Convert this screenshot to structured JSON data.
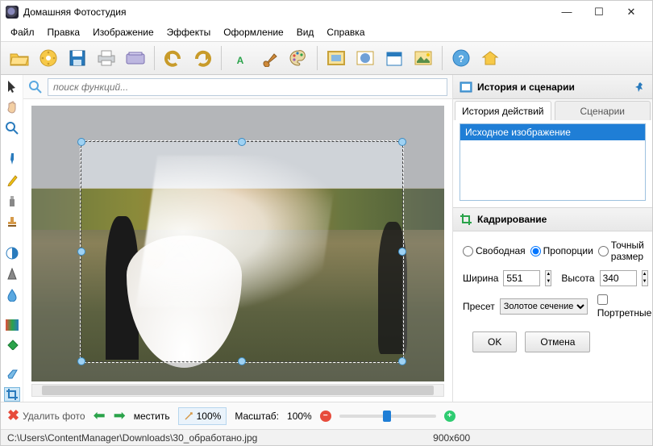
{
  "window": {
    "title": "Домашняя Фотостудия"
  },
  "menubar": [
    "Файл",
    "Правка",
    "Изображение",
    "Эффекты",
    "Оформление",
    "Вид",
    "Справка"
  ],
  "search": {
    "placeholder": "поиск функций..."
  },
  "right": {
    "header": "История и сценарии",
    "tabs": [
      "История действий",
      "Сценарии"
    ],
    "history": [
      "Исходное изображение"
    ],
    "crop_header": "Кадрирование",
    "radios": {
      "free": "Свободная",
      "prop": "Пропорции",
      "exact": "Точный размер"
    },
    "width_label": "Ширина",
    "height_label": "Высота",
    "width": "551",
    "height": "340",
    "preset_label": "Пресет",
    "preset_value": "Золотое сечение",
    "portrait": "Портретные",
    "ok": "OK",
    "cancel": "Отмена"
  },
  "bottom": {
    "delete": "Удалить фото",
    "move": "местить",
    "fit": "100%",
    "scale_label": "Масштаб:",
    "scale_value": "100%"
  },
  "status": {
    "path": "C:\\Users\\ContentManager\\Downloads\\30_обработано.jpg",
    "dims": "900x600"
  }
}
